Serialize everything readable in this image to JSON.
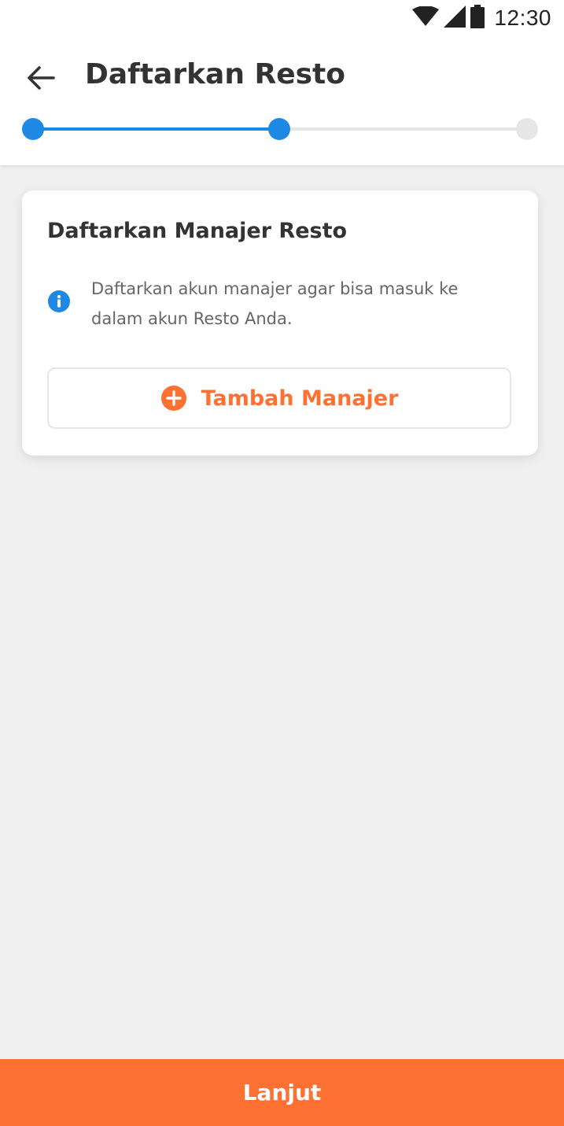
{
  "status_bar": {
    "time": "12:30",
    "icons": [
      "wifi-icon",
      "signal-icon",
      "battery-icon"
    ]
  },
  "header": {
    "back_icon": "arrow-left-icon",
    "title": "Daftarkan Resto"
  },
  "stepper": {
    "total_steps": 3,
    "current_step": 2,
    "active_color": "#1e88e5",
    "inactive_color": "#e6e6e6"
  },
  "card": {
    "title": "Daftarkan Manajer Resto",
    "info_icon": "info-circle-icon",
    "info_text": "Daftarkan akun manajer agar bisa masuk ke dalam akun Resto Anda.",
    "add_button_icon": "plus-circle-icon",
    "add_button_label": "Tambah Manajer"
  },
  "footer": {
    "next_label": "Lanjut"
  },
  "colors": {
    "accent": "#ff7033",
    "primary_blue": "#1e88e5",
    "background": "#f0f0f0"
  }
}
